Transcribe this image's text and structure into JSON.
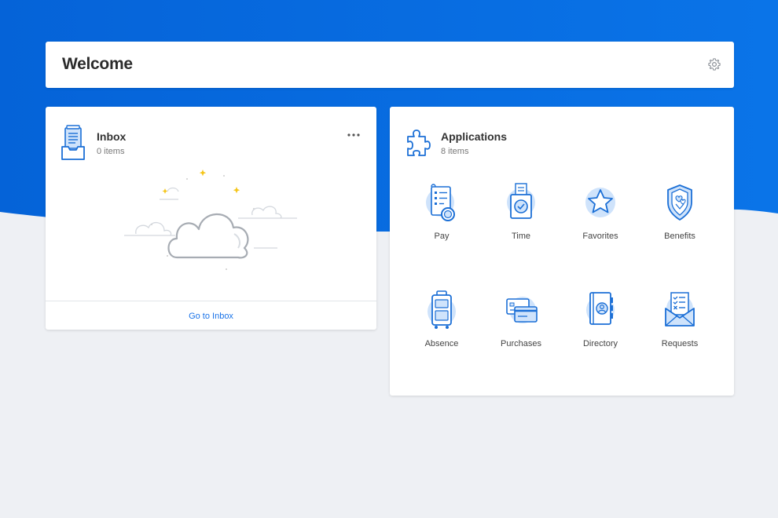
{
  "header": {
    "title": "Welcome",
    "settings_icon": "gear-icon"
  },
  "inbox": {
    "title": "Inbox",
    "count_label": "0 items",
    "link": "Go to Inbox",
    "icon": "inbox-tray-icon"
  },
  "applications": {
    "title": "Applications",
    "count_label": "8 items",
    "icon": "puzzle-icon",
    "items": [
      {
        "label": "Pay",
        "icon": "pay-icon"
      },
      {
        "label": "Time",
        "icon": "time-icon"
      },
      {
        "label": "Favorites",
        "icon": "star-icon"
      },
      {
        "label": "Benefits",
        "icon": "shield-icon"
      },
      {
        "label": "Absence",
        "icon": "suitcase-icon"
      },
      {
        "label": "Purchases",
        "icon": "credit-card-icon"
      },
      {
        "label": "Directory",
        "icon": "directory-book-icon"
      },
      {
        "label": "Requests",
        "icon": "envelope-checklist-icon"
      }
    ]
  },
  "colors": {
    "brand_blue": "#0a6fde",
    "icon_blue": "#1b6fd6",
    "icon_fill": "#cfe3fb",
    "background": "#eef0f4",
    "link": "#1a73e8"
  }
}
